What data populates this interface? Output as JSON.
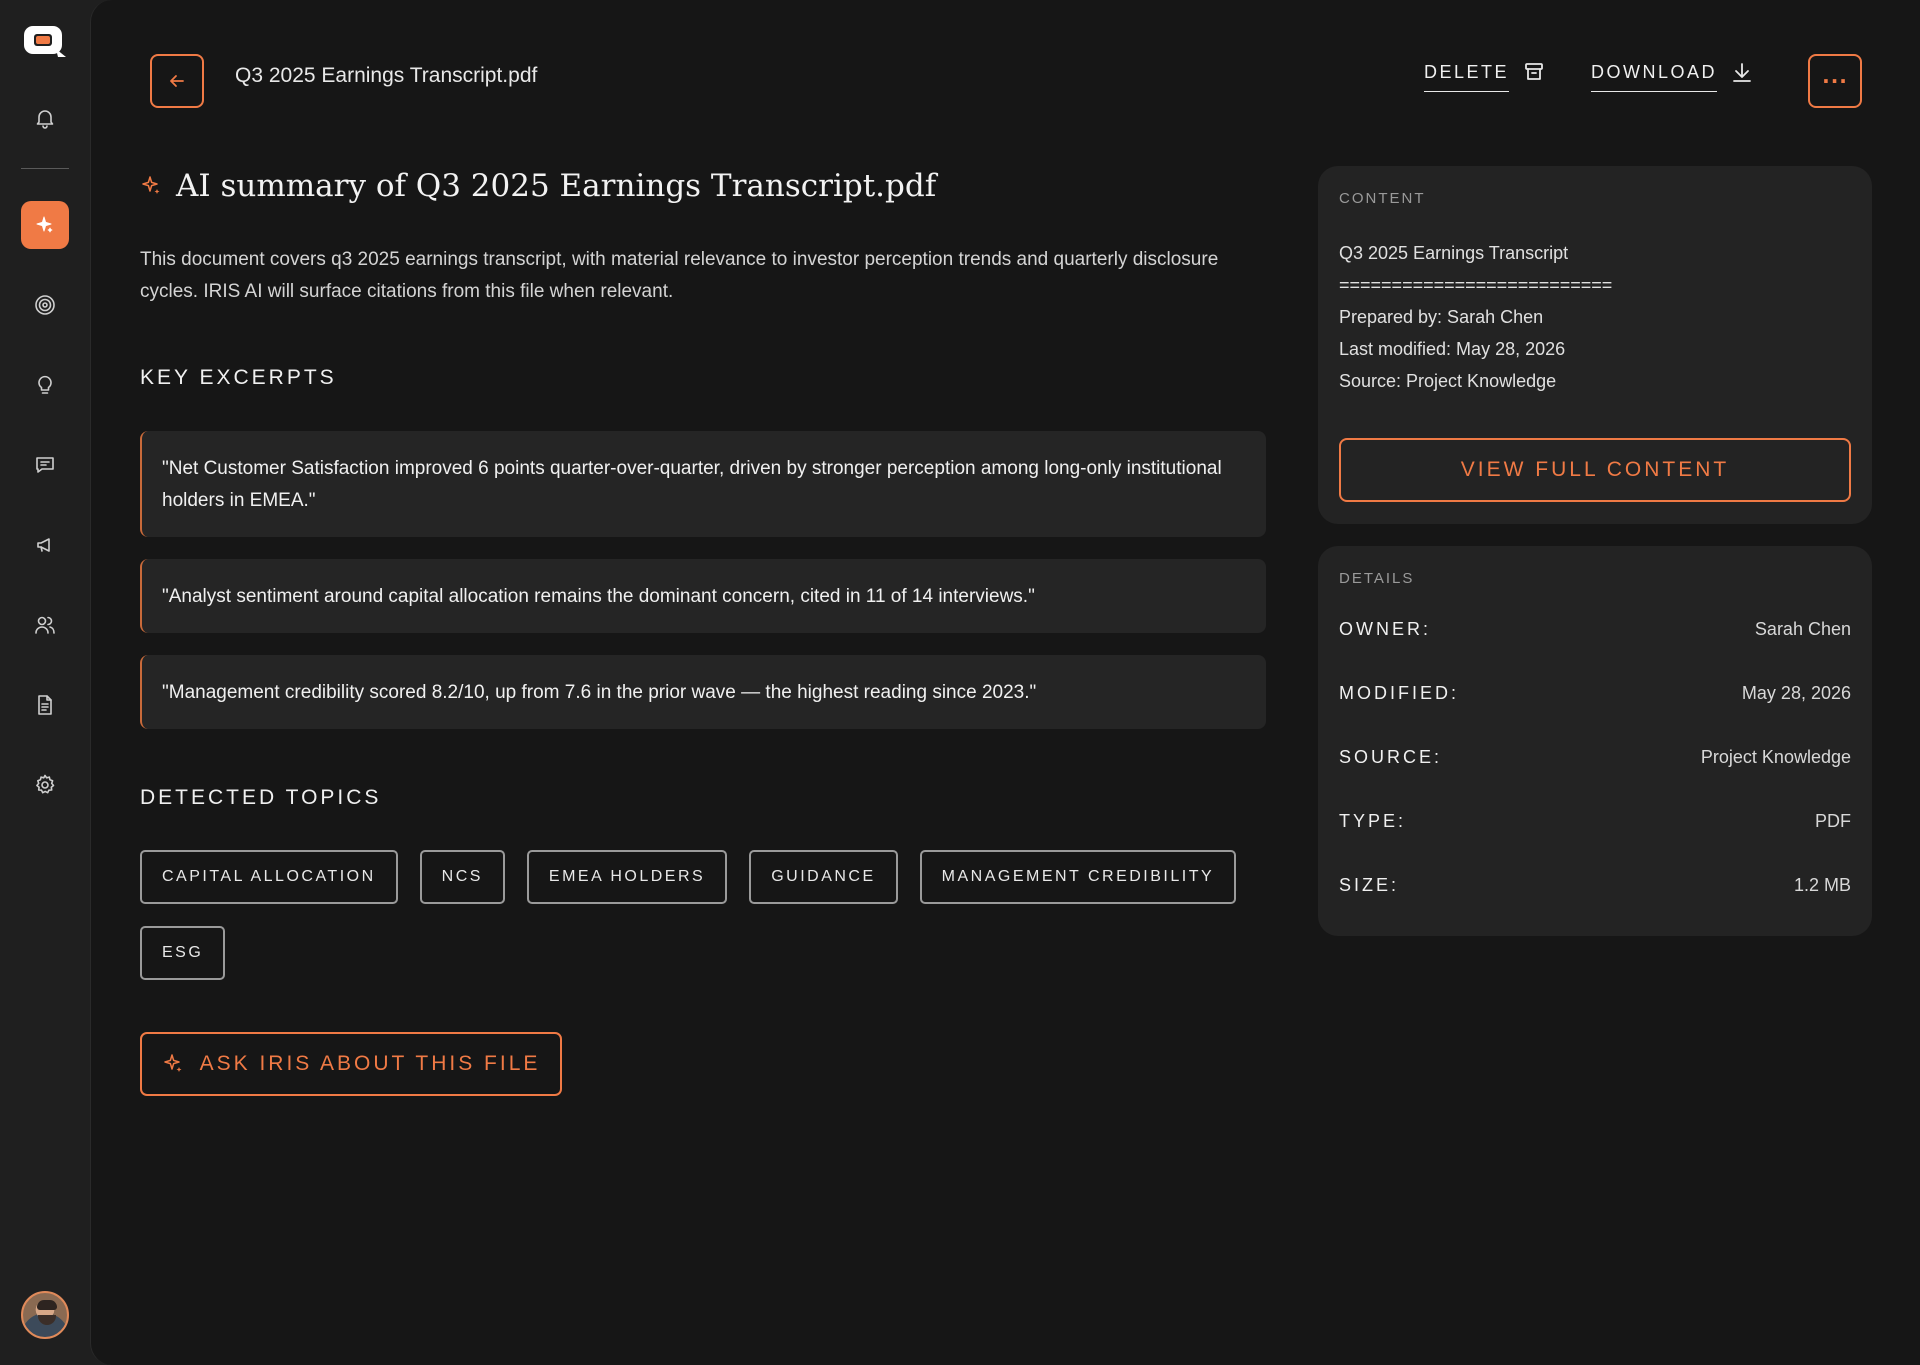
{
  "header": {
    "file_title": "Q3 2025 Earnings Transcript.pdf",
    "delete_label": "DELETE",
    "download_label": "DOWNLOAD",
    "more_label": "···"
  },
  "summary": {
    "title": "AI summary of Q3 2025 Earnings Transcript.pdf",
    "text": "This document covers q3 2025 earnings transcript, with material relevance to investor perception trends and quarterly disclosure cycles. IRIS AI will surface citations from this file when relevant."
  },
  "excerpts": {
    "heading": "KEY EXCERPTS",
    "items": [
      "\"Net Customer Satisfaction improved 6 points quarter-over-quarter, driven by stronger perception among long-only institutional holders in EMEA.\"",
      "\"Analyst sentiment around capital allocation remains the dominant concern, cited in 11 of 14 interviews.\"",
      "\"Management credibility scored 8.2/10, up from 7.6 in the prior wave — the highest reading since 2023.\""
    ]
  },
  "topics": {
    "heading": "DETECTED TOPICS",
    "items": [
      "CAPITAL ALLOCATION",
      "NCS",
      "EMEA HOLDERS",
      "GUIDANCE",
      "MANAGEMENT CREDIBILITY",
      "ESG"
    ]
  },
  "ask_button_label": "ASK IRIS ABOUT THIS FILE",
  "content_card": {
    "label": "CONTENT",
    "lines": [
      "Q3 2025 Earnings Transcript",
      "==========================",
      "Prepared by: Sarah Chen",
      "Last modified: May 28, 2026",
      "Source: Project Knowledge"
    ],
    "button_label": "VIEW FULL CONTENT"
  },
  "details_card": {
    "label": "DETAILS",
    "rows": [
      {
        "key": "OWNER:",
        "value": "Sarah Chen"
      },
      {
        "key": "MODIFIED:",
        "value": "May 28, 2026"
      },
      {
        "key": "SOURCE:",
        "value": "Project Knowledge"
      },
      {
        "key": "TYPE:",
        "value": "PDF"
      },
      {
        "key": "SIZE:",
        "value": "1.2 MB"
      }
    ]
  },
  "sidebar": {
    "icons": [
      "logo-icon",
      "bell-icon",
      "sparkle-icon",
      "target-icon",
      "lightbulb-icon",
      "message-icon",
      "megaphone-icon",
      "users-icon",
      "document-icon",
      "gear-icon"
    ]
  },
  "colors": {
    "accent": "#f07a45",
    "background": "#161616",
    "sidebar": "#1f1f1f",
    "card": "#232323"
  }
}
